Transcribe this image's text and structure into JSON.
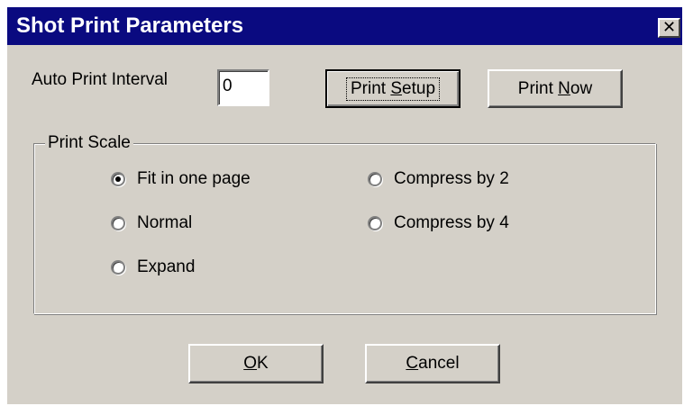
{
  "window": {
    "title": "Shot Print Parameters",
    "close_glyph": "✕"
  },
  "auto_print": {
    "label": "Auto Print Interval",
    "value": "0"
  },
  "buttons": {
    "print_setup": {
      "pre": "Print ",
      "mnemonic": "S",
      "post": "etup"
    },
    "print_now": {
      "pre": "Print ",
      "mnemonic": "N",
      "post": "ow"
    },
    "ok": {
      "pre": "",
      "mnemonic": "O",
      "post": "K"
    },
    "cancel": {
      "pre": "",
      "mnemonic": "C",
      "post": "ancel"
    }
  },
  "print_scale": {
    "label": "Print Scale",
    "selected": "Fit in one page",
    "options": [
      {
        "label": "Fit in one page",
        "checked": true
      },
      {
        "label": "Normal",
        "checked": false
      },
      {
        "label": "Expand",
        "checked": false
      },
      {
        "label": "Compress by 2",
        "checked": false
      },
      {
        "label": "Compress by 4",
        "checked": false
      }
    ]
  },
  "colors": {
    "titlebar": "#0a0a80",
    "face": "#d4d0c8"
  },
  "icons": {
    "close": "close-icon",
    "radio": "radio-button-icon"
  }
}
